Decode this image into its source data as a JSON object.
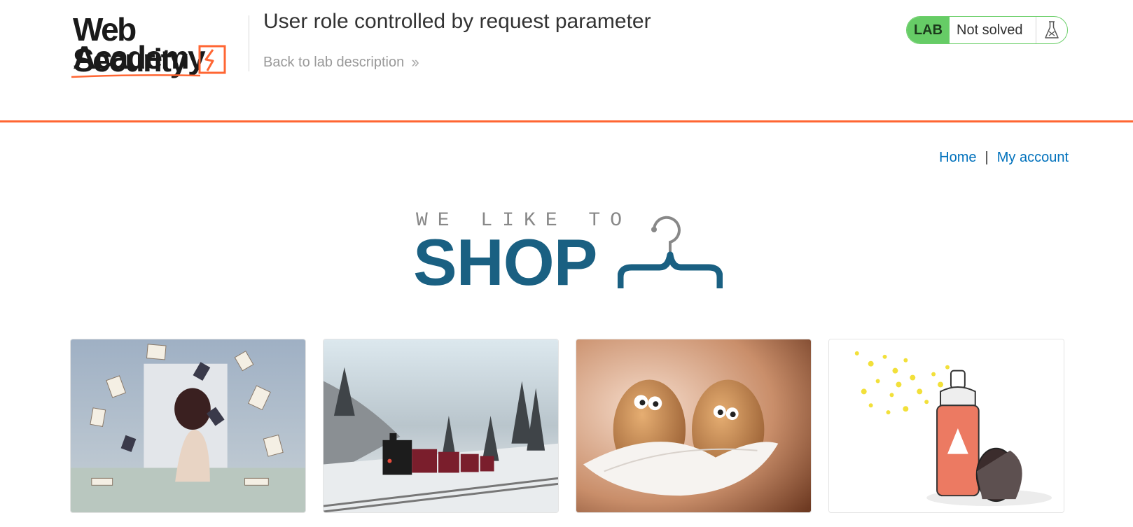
{
  "academy": {
    "logo_line1": "Web Security",
    "logo_line2": "Academy",
    "lab_title": "User role controlled by request parameter",
    "back_link": "Back to lab description",
    "lab_badge": "LAB",
    "lab_status": "Not solved"
  },
  "nav": {
    "home": "Home",
    "separator": "|",
    "my_account": "My account"
  },
  "banner": {
    "small": "WE LIKE TO",
    "big": "SHOP"
  },
  "products": [
    {
      "image": "woman-with-flying-books"
    },
    {
      "image": "steam-train-in-snow"
    },
    {
      "image": "two-eggs-on-feathers"
    },
    {
      "image": "spray-paint-can"
    }
  ],
  "colors": {
    "accent_orange": "#ff6633",
    "lab_green": "#66cc66",
    "link_blue": "#0071bc",
    "shop_blue": "#1a6082"
  }
}
